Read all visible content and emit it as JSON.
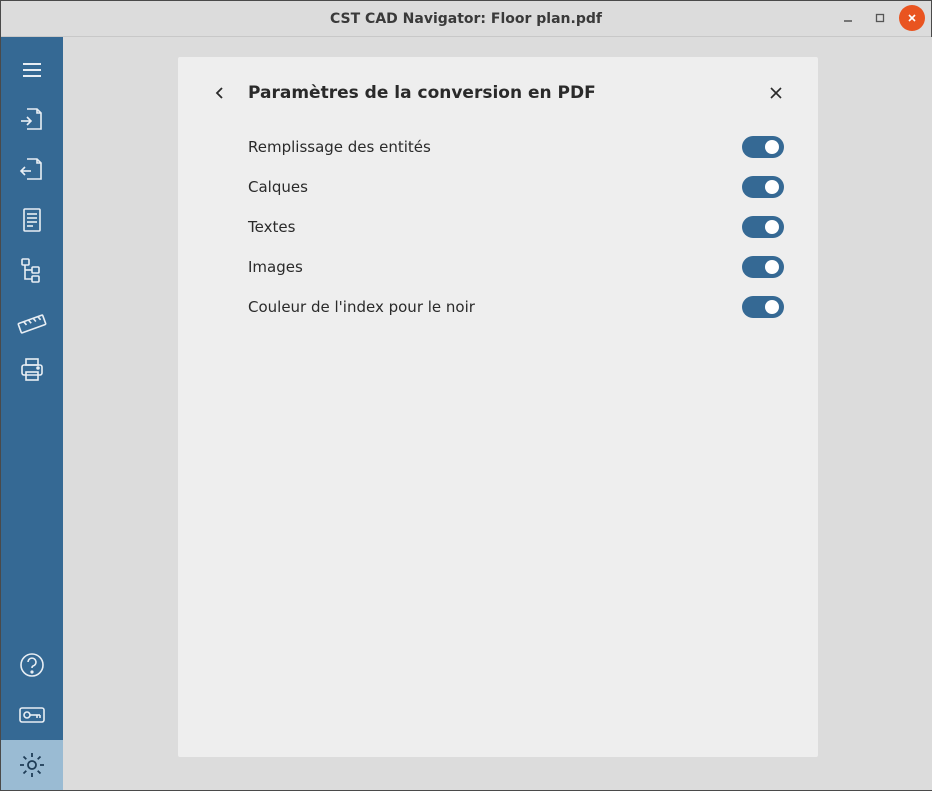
{
  "window": {
    "title": "CST CAD Navigator: Floor plan.pdf"
  },
  "sidebar": {
    "items": [
      {
        "name": "menu"
      },
      {
        "name": "import"
      },
      {
        "name": "export"
      },
      {
        "name": "pages"
      },
      {
        "name": "structure"
      },
      {
        "name": "measure"
      },
      {
        "name": "print"
      }
    ],
    "bottomItems": [
      {
        "name": "help"
      },
      {
        "name": "license"
      },
      {
        "name": "settings",
        "active": true
      }
    ]
  },
  "panel": {
    "title": "Paramètres de la conversion en PDF",
    "settings": [
      {
        "label": "Remplissage des entités",
        "value": true
      },
      {
        "label": "Calques",
        "value": true
      },
      {
        "label": "Textes",
        "value": true
      },
      {
        "label": "Images",
        "value": true
      },
      {
        "label": "Couleur de l'index pour le noir",
        "value": true
      }
    ]
  },
  "colors": {
    "accent": "#356994",
    "panelBg": "#eeeeee",
    "bodyBg": "#dcdcdc"
  }
}
